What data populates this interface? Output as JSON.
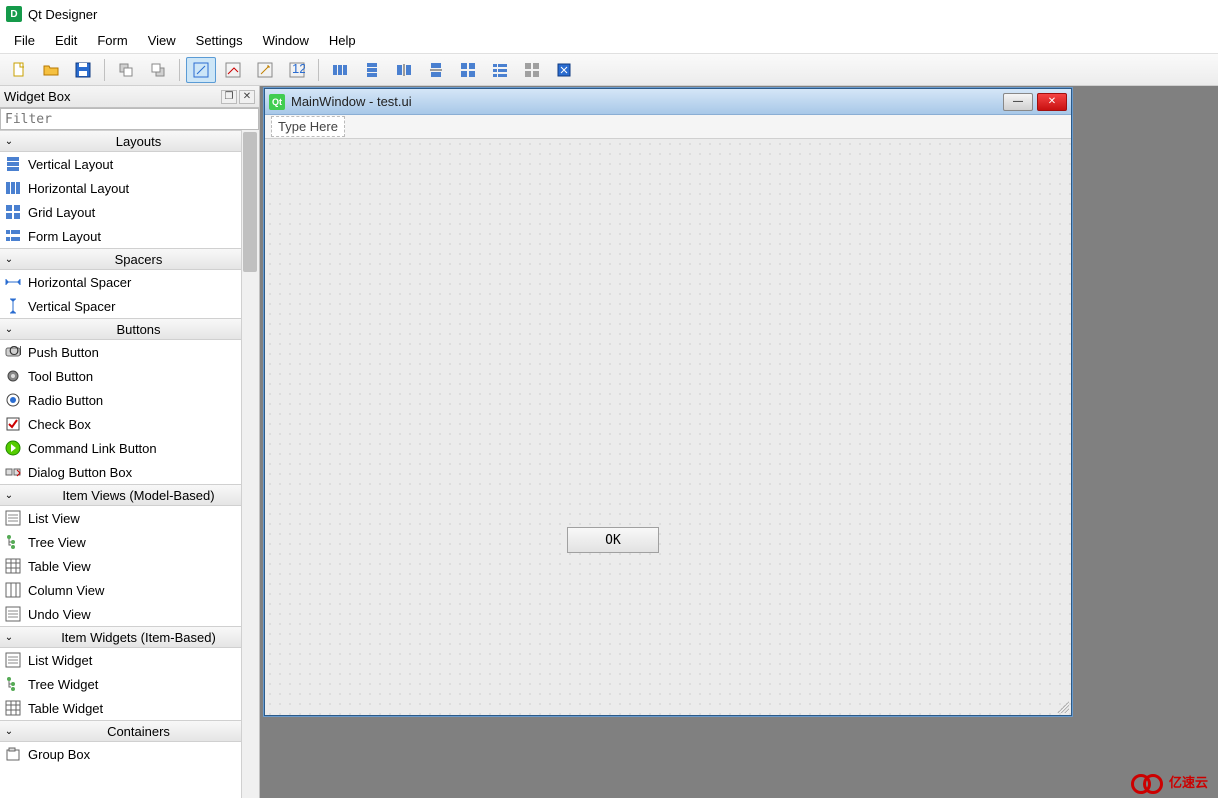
{
  "app": {
    "title": "Qt Designer"
  },
  "menubar": [
    "File",
    "Edit",
    "Form",
    "View",
    "Settings",
    "Window",
    "Help"
  ],
  "dock": {
    "title": "Widget Box",
    "filter_placeholder": "Filter"
  },
  "categories": [
    {
      "name": "Layouts",
      "items": [
        "Vertical Layout",
        "Horizontal Layout",
        "Grid Layout",
        "Form Layout"
      ]
    },
    {
      "name": "Spacers",
      "items": [
        "Horizontal Spacer",
        "Vertical Spacer"
      ]
    },
    {
      "name": "Buttons",
      "items": [
        "Push Button",
        "Tool Button",
        "Radio Button",
        "Check Box",
        "Command Link Button",
        "Dialog Button Box"
      ]
    },
    {
      "name": "Item Views (Model-Based)",
      "items": [
        "List View",
        "Tree View",
        "Table View",
        "Column View",
        "Undo View"
      ]
    },
    {
      "name": "Item Widgets (Item-Based)",
      "items": [
        "List Widget",
        "Tree Widget",
        "Table Widget"
      ]
    },
    {
      "name": "Containers",
      "items": [
        "Group Box"
      ]
    }
  ],
  "form": {
    "title": "MainWindow - test.ui",
    "menu_hint": "Type Here",
    "ok_label": "OK"
  },
  "watermark": "亿速云"
}
